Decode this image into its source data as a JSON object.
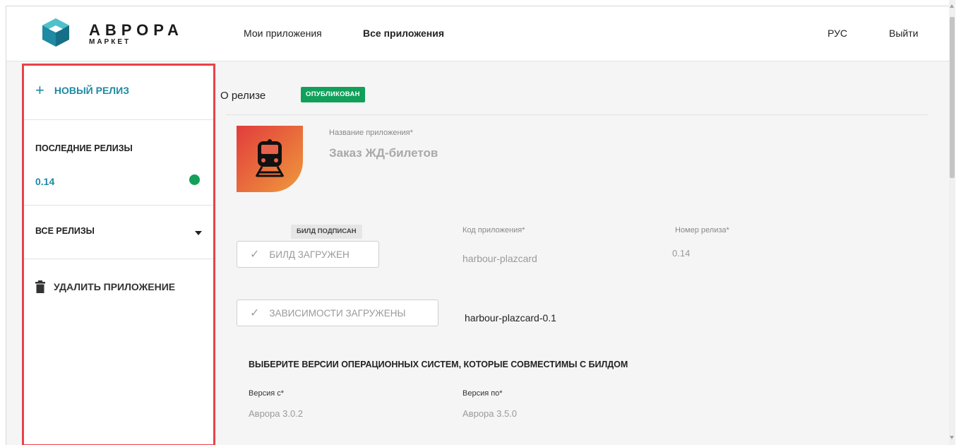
{
  "header": {
    "logo_title": "АВРОРА",
    "logo_subtitle": "МАРКЕТ",
    "nav": {
      "my_apps": "Мои приложения",
      "all_apps": "Все приложения"
    },
    "language": "РУС",
    "logout": "Выйти"
  },
  "sidebar": {
    "new_release": "НОВЫЙ РЕЛИЗ",
    "recent_heading": "ПОСЛЕДНИЕ РЕЛИЗЫ",
    "recent_release": "0.14",
    "all_releases": "ВСЕ РЕЛИЗЫ",
    "delete_app": "УДАЛИТЬ ПРИЛОЖЕНИЕ"
  },
  "main": {
    "title": "О релизе",
    "status": "ОПУБЛИКОВАН",
    "app_name_label": "Название приложения*",
    "app_name": "Заказ ЖД-билетов",
    "build_signed": "БИЛД ПОДПИСАН",
    "build_uploaded": "БИЛД ЗАГРУЖЕН",
    "app_code_label": "Код приложения*",
    "app_code": "harbour-plazcard",
    "release_number_label": "Номер релиза*",
    "release_number": "0.14",
    "deps_uploaded": "ЗАВИСИМОСТИ ЗАГРУЖЕНЫ",
    "deps_name": "harbour-plazcard-0.1",
    "os_heading": "ВЫБЕРИТЕ ВЕРСИИ ОПЕРАЦИОННЫХ СИСТЕМ, КОТОРЫЕ СОВМЕСТИМЫ С БИЛДОМ",
    "version_from_label": "Версия с*",
    "version_from": "Аврора 3.0.2",
    "version_to_label": "Версия по*",
    "version_to": "Аврора 3.5.0"
  },
  "colors": {
    "accent": "#1e8aa3",
    "published": "#10a05a",
    "highlight": "#e8424a"
  },
  "icons": {
    "logo": "aurora-cube-icon",
    "new_release": "plus-icon",
    "dropdown": "caret-down-icon",
    "delete": "trash-icon",
    "check": "check-icon",
    "app": "train-icon"
  }
}
